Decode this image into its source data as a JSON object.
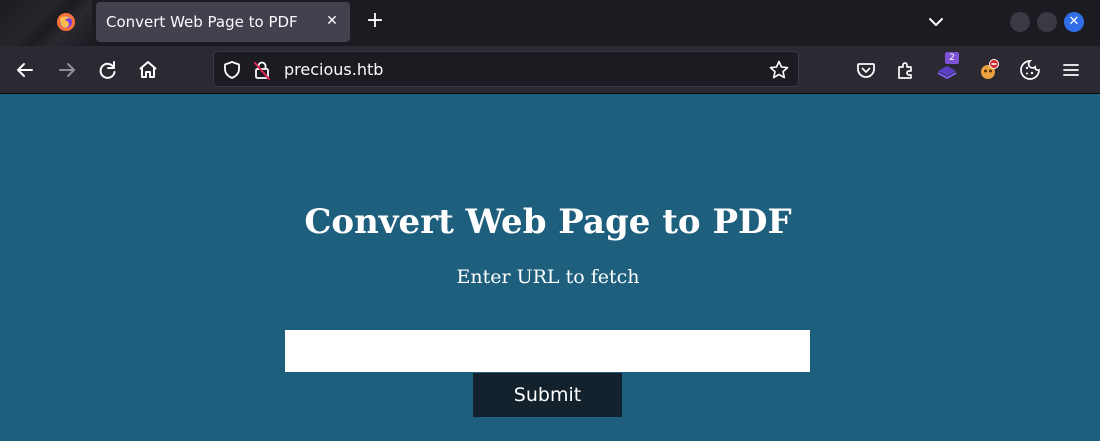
{
  "browser": {
    "tab": {
      "title": "Convert Web Page to PDF",
      "close_glyph": "✕"
    },
    "new_tab_glyph": "+",
    "window_close_glyph": "✕",
    "address_bar": {
      "url": "precious.htb"
    },
    "extensions": {
      "badge_count": "2"
    },
    "icons": [
      "firefox-logo-icon",
      "back-arrow-icon",
      "forward-arrow-icon",
      "reload-icon",
      "home-icon",
      "shield-icon",
      "insecure-lock-icon",
      "bookmark-star-icon",
      "pocket-icon",
      "extensions-puzzle-icon",
      "foxyproxy-icon",
      "ublock-icon",
      "cookie-icon",
      "hamburger-menu-icon",
      "list-all-tabs-chevron-icon"
    ],
    "accent_color": "#2f6ee6"
  },
  "page": {
    "background_color": "#1f5f7e",
    "title": "Convert Web Page to PDF",
    "subtitle": "Enter URL to fetch",
    "url_input": {
      "value": "",
      "placeholder": ""
    },
    "submit_label": "Submit",
    "button_color": "#13212c"
  }
}
